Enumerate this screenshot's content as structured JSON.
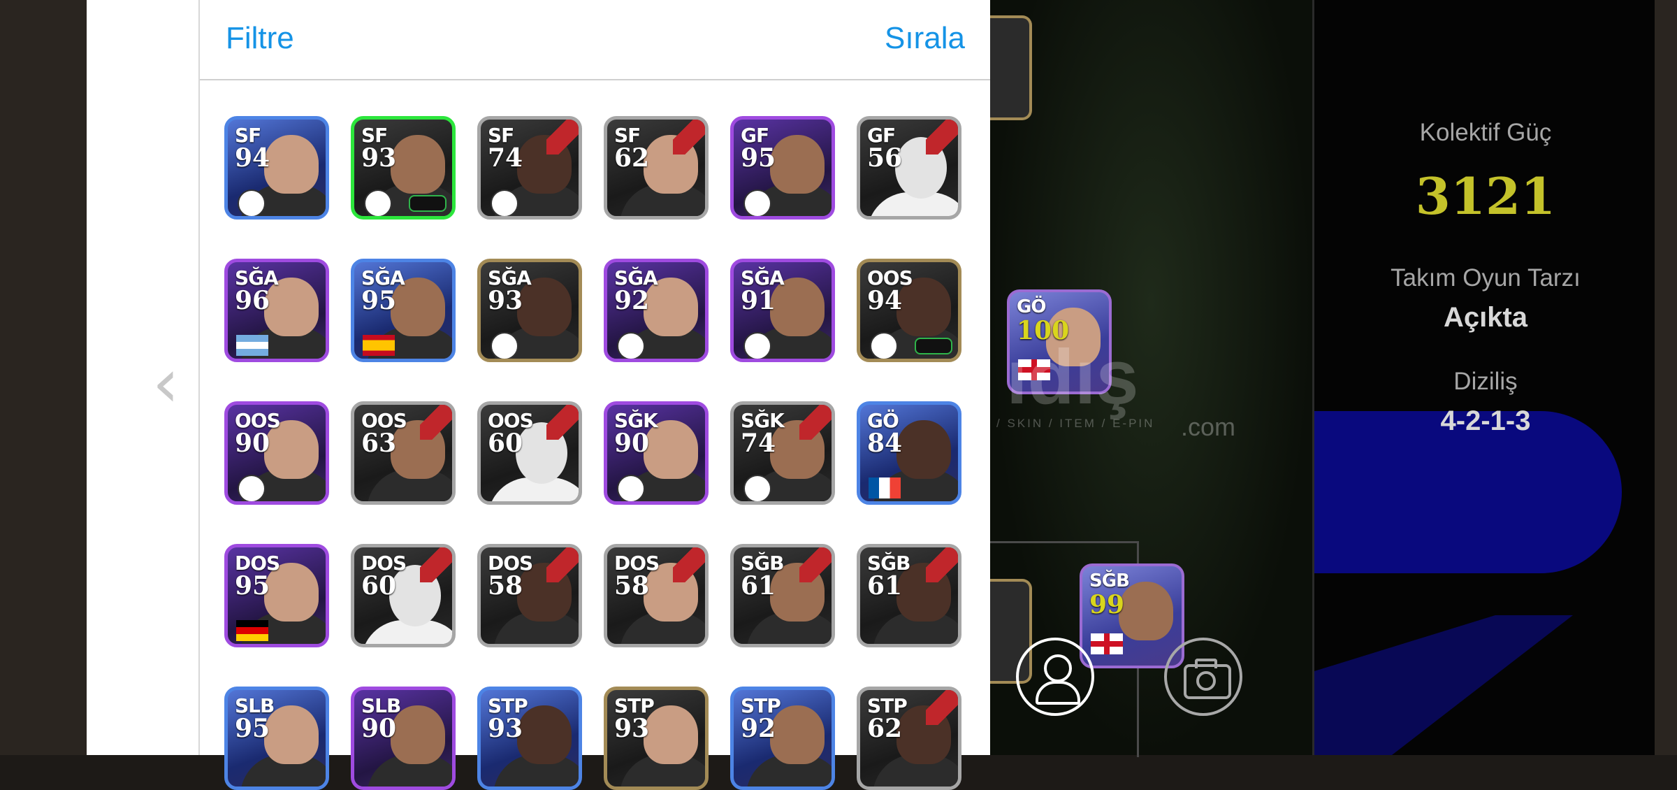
{
  "header": {
    "filter_label": "Filtre",
    "sort_label": "Sırala"
  },
  "back_icon": "chevron-left-icon",
  "cards": [
    {
      "pos": "SF",
      "rating": "94",
      "frame": "blue",
      "marker": "badge"
    },
    {
      "pos": "SF",
      "rating": "93",
      "frame": "green",
      "marker": "badge"
    },
    {
      "pos": "SF",
      "rating": "74",
      "frame": "gray",
      "marker": "badge"
    },
    {
      "pos": "SF",
      "rating": "62",
      "frame": "gray",
      "marker": "none"
    },
    {
      "pos": "GF",
      "rating": "95",
      "frame": "purple",
      "marker": "badge"
    },
    {
      "pos": "GF",
      "rating": "56",
      "frame": "gray",
      "marker": "none"
    },
    {
      "pos": "SĞA",
      "rating": "96",
      "frame": "purple",
      "marker": "flag-ar"
    },
    {
      "pos": "SĞA",
      "rating": "95",
      "frame": "blue",
      "marker": "flag-es"
    },
    {
      "pos": "SĞA",
      "rating": "93",
      "frame": "gold",
      "marker": "badge"
    },
    {
      "pos": "SĞA",
      "rating": "92",
      "frame": "purple",
      "marker": "badge"
    },
    {
      "pos": "SĞA",
      "rating": "91",
      "frame": "purple",
      "marker": "badge"
    },
    {
      "pos": "OOS",
      "rating": "94",
      "frame": "gold",
      "marker": "badge"
    },
    {
      "pos": "OOS",
      "rating": "90",
      "frame": "purple",
      "marker": "badge"
    },
    {
      "pos": "OOS",
      "rating": "63",
      "frame": "gray",
      "marker": "none"
    },
    {
      "pos": "OOS",
      "rating": "60",
      "frame": "gray",
      "marker": "none"
    },
    {
      "pos": "SĞK",
      "rating": "90",
      "frame": "purple",
      "marker": "badge"
    },
    {
      "pos": "SĞK",
      "rating": "74",
      "frame": "gray",
      "marker": "badge"
    },
    {
      "pos": "GÖ",
      "rating": "84",
      "frame": "blue",
      "marker": "flag-fr"
    },
    {
      "pos": "DOS",
      "rating": "95",
      "frame": "purple",
      "marker": "flag-de"
    },
    {
      "pos": "DOS",
      "rating": "60",
      "frame": "gray",
      "marker": "none"
    },
    {
      "pos": "DOS",
      "rating": "58",
      "frame": "gray",
      "marker": "none"
    },
    {
      "pos": "DOS",
      "rating": "58",
      "frame": "gray",
      "marker": "none"
    },
    {
      "pos": "SĞB",
      "rating": "61",
      "frame": "gray",
      "marker": "none"
    },
    {
      "pos": "SĞB",
      "rating": "61",
      "frame": "gray",
      "marker": "none"
    },
    {
      "pos": "SLB",
      "rating": "95",
      "frame": "blue",
      "marker": "none"
    },
    {
      "pos": "SLB",
      "rating": "90",
      "frame": "purple",
      "marker": "none"
    },
    {
      "pos": "STP",
      "rating": "93",
      "frame": "blue",
      "marker": "none"
    },
    {
      "pos": "STP",
      "rating": "93",
      "frame": "gold",
      "marker": "none"
    },
    {
      "pos": "STP",
      "rating": "92",
      "frame": "blue",
      "marker": "none"
    },
    {
      "pos": "STP",
      "rating": "62",
      "frame": "gray",
      "marker": "none"
    }
  ],
  "pitch": {
    "card_go": {
      "pos": "GÖ",
      "rating": "100"
    },
    "card_sgb": {
      "pos": "SĞB",
      "rating": "99"
    },
    "watermark_text": "ıdış",
    "watermark_sub": "/ SKIN / ITEM / E-PIN",
    "watermark_com": ".com"
  },
  "buttons": {
    "person_icon": "person-icon",
    "camera_icon": "camera-icon"
  },
  "team": {
    "collective_label": "Kolektif Güç",
    "collective_value": "3121",
    "style_label": "Takım Oyun Tarzı",
    "style_value": "Açıkta",
    "formation_label": "Diziliş",
    "formation_value": "4-2-1-3"
  },
  "colors": {
    "accent": "#1593e6",
    "power": "#c4c22a"
  }
}
